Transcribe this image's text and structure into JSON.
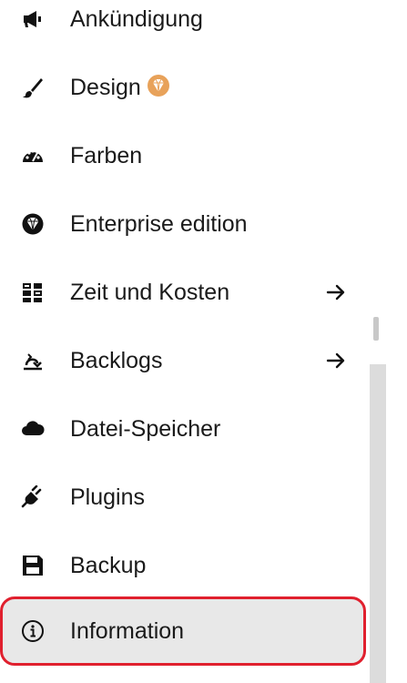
{
  "menu": {
    "items": [
      {
        "label": "Ankündigung",
        "icon": "megaphone-icon"
      },
      {
        "label": "Design",
        "icon": "paintbrush-icon",
        "badge": "enterprise-gem-icon"
      },
      {
        "label": "Farben",
        "icon": "palette-gauge-icon"
      },
      {
        "label": "Enterprise edition",
        "icon": "gem-icon"
      },
      {
        "label": "Zeit und Kosten",
        "icon": "time-cost-icon",
        "submenu": true
      },
      {
        "label": "Backlogs",
        "icon": "backlogs-icon",
        "submenu": true
      },
      {
        "label": "Datei-Speicher",
        "icon": "cloud-icon"
      },
      {
        "label": "Plugins",
        "icon": "plug-icon"
      },
      {
        "label": "Backup",
        "icon": "floppy-disk-icon"
      },
      {
        "label": "Information",
        "icon": "info-circle-icon",
        "active": true
      }
    ]
  },
  "colors": {
    "active_background": "#e8e8e8",
    "active_border": "#e0202e",
    "badge": "#e8a25a",
    "text": "#1a1a1a"
  }
}
